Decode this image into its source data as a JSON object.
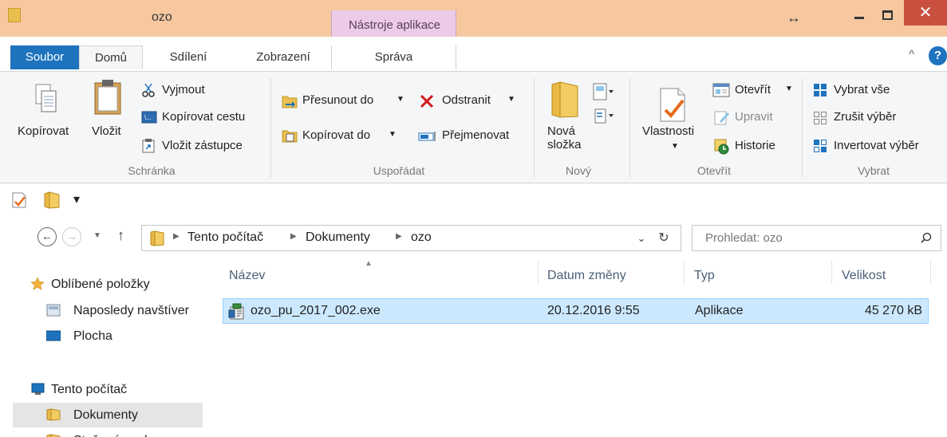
{
  "window": {
    "title": "ozo",
    "context_tab": "Nástroje aplikace",
    "close_glyph": "✕"
  },
  "tabs": {
    "file": "Soubor",
    "items": [
      "Domů",
      "Sdílení",
      "Zobrazení",
      "Správa"
    ],
    "active": "Domů"
  },
  "ribbon": {
    "clipboard": {
      "copy": "Kopírovat",
      "paste": "Vložit",
      "cut": "Vyjmout",
      "copy_path": "Kopírovat cestu",
      "paste_shortcut": "Vložit zástupce",
      "label": "Schránka"
    },
    "organize": {
      "move_to": "Přesunout do",
      "copy_to": "Kopírovat do",
      "delete": "Odstranit",
      "rename": "Přejmenovat",
      "label": "Uspořádat"
    },
    "new": {
      "new_folder_1": "Nová",
      "new_folder_2": "složka",
      "label": "Nový"
    },
    "open": {
      "properties": "Vlastnosti",
      "open": "Otevřít",
      "edit": "Upravit",
      "history": "Historie",
      "label": "Otevřít"
    },
    "select": {
      "select_all": "Vybrat vše",
      "select_none": "Zrušit výběr",
      "invert": "Invertovat výběr",
      "label": "Vybrat"
    }
  },
  "qat": {
    "dropdown_glyph": "▾"
  },
  "address": {
    "crumbs": [
      "Tento počítač",
      "Dokumenty",
      "ozo"
    ]
  },
  "search": {
    "placeholder": "Prohledat: ozo"
  },
  "navpane": {
    "favorites": "Oblíbené položky",
    "recent": "Naposledy navštíver",
    "desktop": "Plocha",
    "this_pc": "Tento počítač",
    "documents": "Dokumenty",
    "downloads": "Stažené soubory"
  },
  "columns": {
    "name": "Název",
    "date": "Datum změny",
    "type": "Typ",
    "size": "Velikost"
  },
  "files": [
    {
      "name": "ozo_pu_2017_002.exe",
      "date": "20.12.2016 9:55",
      "type": "Aplikace",
      "size": "45 270 kB"
    }
  ],
  "colors": {
    "accent": "#1e73be",
    "titlebar": "#f7c8a0",
    "context_tab": "#eccbe6",
    "selection": "#cce8ff"
  }
}
